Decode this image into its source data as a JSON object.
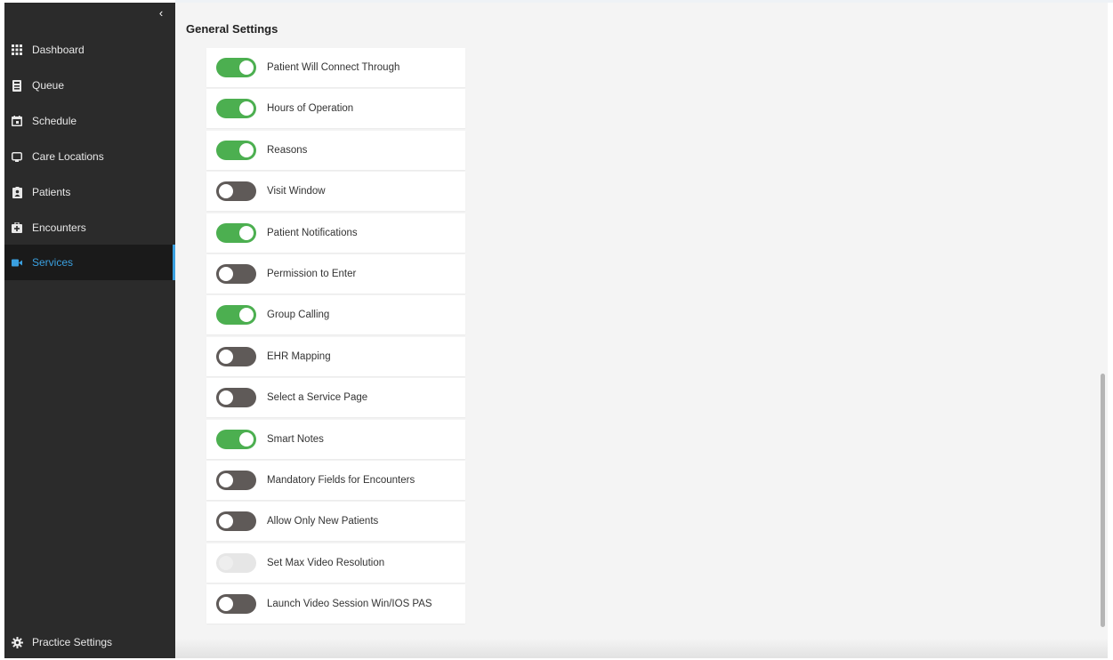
{
  "sidebar": {
    "collapse_glyph": "‹",
    "items": [
      {
        "label": "Dashboard",
        "icon": "grid-icon"
      },
      {
        "label": "Queue",
        "icon": "queue-icon"
      },
      {
        "label": "Schedule",
        "icon": "calendar-icon"
      },
      {
        "label": "Care Locations",
        "icon": "monitor-icon"
      },
      {
        "label": "Patients",
        "icon": "patient-badge-icon"
      },
      {
        "label": "Encounters",
        "icon": "medical-case-icon"
      },
      {
        "label": "Services",
        "icon": "video-camera-icon",
        "active": true
      }
    ],
    "footer": {
      "label": "Practice Settings",
      "icon": "gear-icon"
    }
  },
  "main": {
    "title": "General Settings",
    "settings": [
      {
        "label": "Patient Will Connect Through",
        "state": "on"
      },
      {
        "label": "Hours of Operation",
        "state": "on"
      },
      {
        "label": "Reasons",
        "state": "on"
      },
      {
        "label": "Visit Window",
        "state": "off"
      },
      {
        "label": "Patient Notifications",
        "state": "on"
      },
      {
        "label": "Permission to Enter",
        "state": "off"
      },
      {
        "label": "Group Calling",
        "state": "on"
      },
      {
        "label": "EHR Mapping",
        "state": "off"
      },
      {
        "label": "Select a Service Page",
        "state": "off"
      },
      {
        "label": "Smart Notes",
        "state": "on"
      },
      {
        "label": "Mandatory Fields for Encounters",
        "state": "off"
      },
      {
        "label": "Allow Only New Patients",
        "state": "off"
      },
      {
        "label": "Set Max Video Resolution",
        "state": "disabled"
      },
      {
        "label": "Launch Video Session Win/IOS PAS",
        "state": "off"
      }
    ]
  },
  "colors": {
    "sidebar_bg": "#2b2b2b",
    "active_accent": "#3aa0e0",
    "toggle_on": "#4caf50",
    "toggle_off": "#5f5a58",
    "toggle_disabled": "#e6e6e6"
  }
}
